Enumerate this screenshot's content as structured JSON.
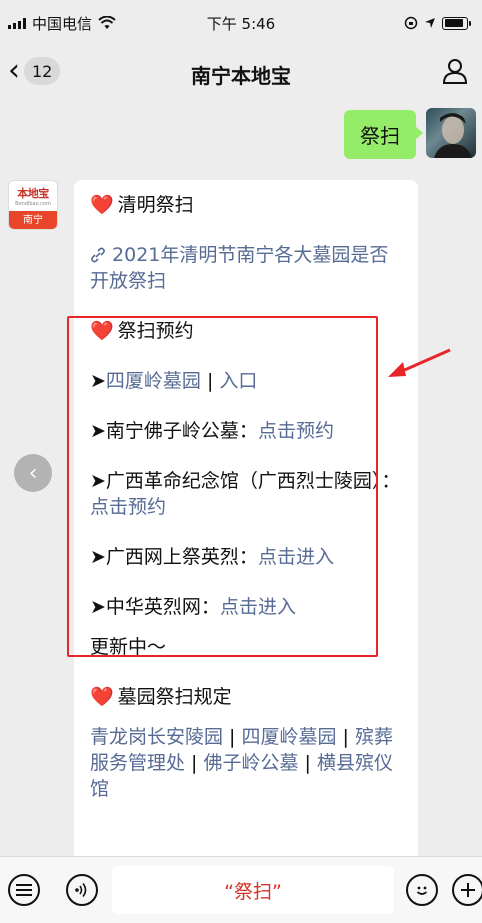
{
  "status": {
    "carrier": "中国电信",
    "time": "下午 5:46",
    "battery_level": 0.9
  },
  "nav": {
    "unread_count": "12",
    "title": "南宁本地宝"
  },
  "my_message": "祭扫",
  "bot_avatar": {
    "logo": "本地宝",
    "domain": "Bendibao.com",
    "city": "南宁"
  },
  "reply": {
    "section1": "清明祭扫",
    "article_link": "2021年清明节南宁各大墓园是否开放祭扫",
    "section2": "祭扫预约",
    "items": [
      {
        "arrow": "➤",
        "name": "四厦岭墓园",
        "sep": " | ",
        "action": "入口"
      },
      {
        "arrow": "➤",
        "name": "南宁佛子岭公墓：",
        "action": "点击预约"
      },
      {
        "arrow": "➤",
        "name": "广西革命纪念馆（广西烈士陵园）：",
        "action": "点击预约"
      },
      {
        "arrow": "➤",
        "name": "广西网上祭英烈：",
        "action": "点击进入"
      },
      {
        "arrow": "➤",
        "name": "中华英烈网：",
        "action": "点击进入"
      }
    ],
    "updating": "更新中～",
    "section3": "墓园祭扫规定",
    "rules_links": [
      "青龙岗长安陵园",
      "四厦岭墓园",
      "殡葬服务管理处",
      "佛子岭公墓",
      "横县殡仪馆"
    ],
    "rules_sep": " | "
  },
  "input": {
    "text": "“祭扫”"
  },
  "icons": {
    "heart": "❤️",
    "link": "link-icon"
  },
  "colors": {
    "bubble_me": "#95ec69",
    "link": "#576b95",
    "annotation": "#e8262a"
  }
}
